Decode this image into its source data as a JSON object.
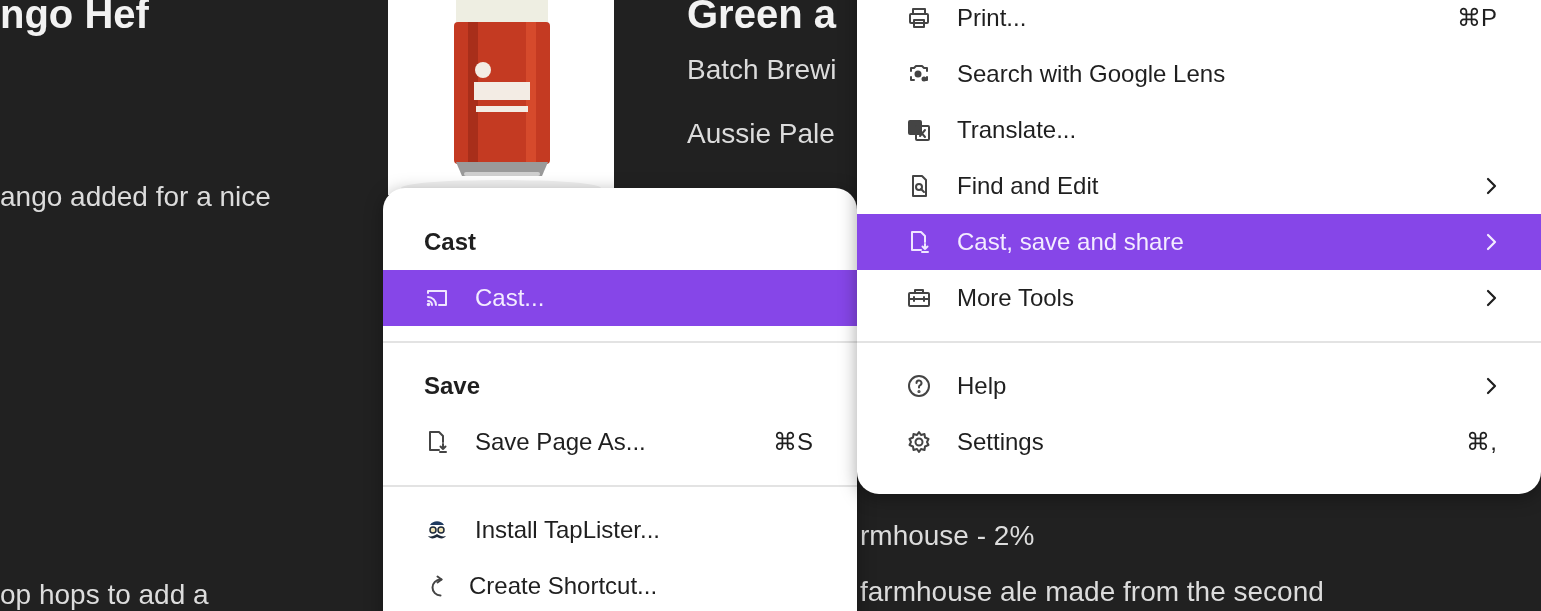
{
  "page": {
    "left_column": {
      "heading": "ngo Hef",
      "paragraphs": [
        "ango added for a nice",
        "op hops to add a"
      ]
    },
    "right_column": {
      "heading": "Green a",
      "lines": [
        "Batch Brewi",
        "Aussie Pale"
      ],
      "lower_lines": [
        "rmhouse - 2%",
        "farmhouse ale made from the second"
      ]
    }
  },
  "main_menu": {
    "items": [
      {
        "kind": "item",
        "label": "Print...",
        "shortcut": "⌘P",
        "has_submenu": false,
        "selected": false
      },
      {
        "kind": "item",
        "label": "Search with Google Lens",
        "has_submenu": false,
        "selected": false
      },
      {
        "kind": "item",
        "label": "Translate...",
        "has_submenu": false,
        "selected": false
      },
      {
        "kind": "item",
        "label": "Find and Edit",
        "has_submenu": true,
        "selected": false
      },
      {
        "kind": "item",
        "label": "Cast, save and share",
        "has_submenu": true,
        "selected": true
      },
      {
        "kind": "item",
        "label": "More Tools",
        "has_submenu": true,
        "selected": false
      },
      {
        "kind": "divider"
      },
      {
        "kind": "item",
        "label": "Help",
        "has_submenu": true,
        "selected": false
      },
      {
        "kind": "item",
        "label": "Settings",
        "shortcut": "⌘,",
        "has_submenu": false,
        "selected": false
      }
    ]
  },
  "submenu": {
    "items": [
      {
        "kind": "header",
        "label": "Cast"
      },
      {
        "kind": "item",
        "label": "Cast...",
        "selected": true
      },
      {
        "kind": "divider"
      },
      {
        "kind": "header",
        "label": "Save"
      },
      {
        "kind": "item",
        "label": "Save Page As...",
        "shortcut": "⌘S",
        "selected": false
      },
      {
        "kind": "divider"
      },
      {
        "kind": "item",
        "label": "Install TapLister...",
        "selected": false
      },
      {
        "kind": "item",
        "label": "Create Shortcut...",
        "selected": false
      }
    ]
  }
}
